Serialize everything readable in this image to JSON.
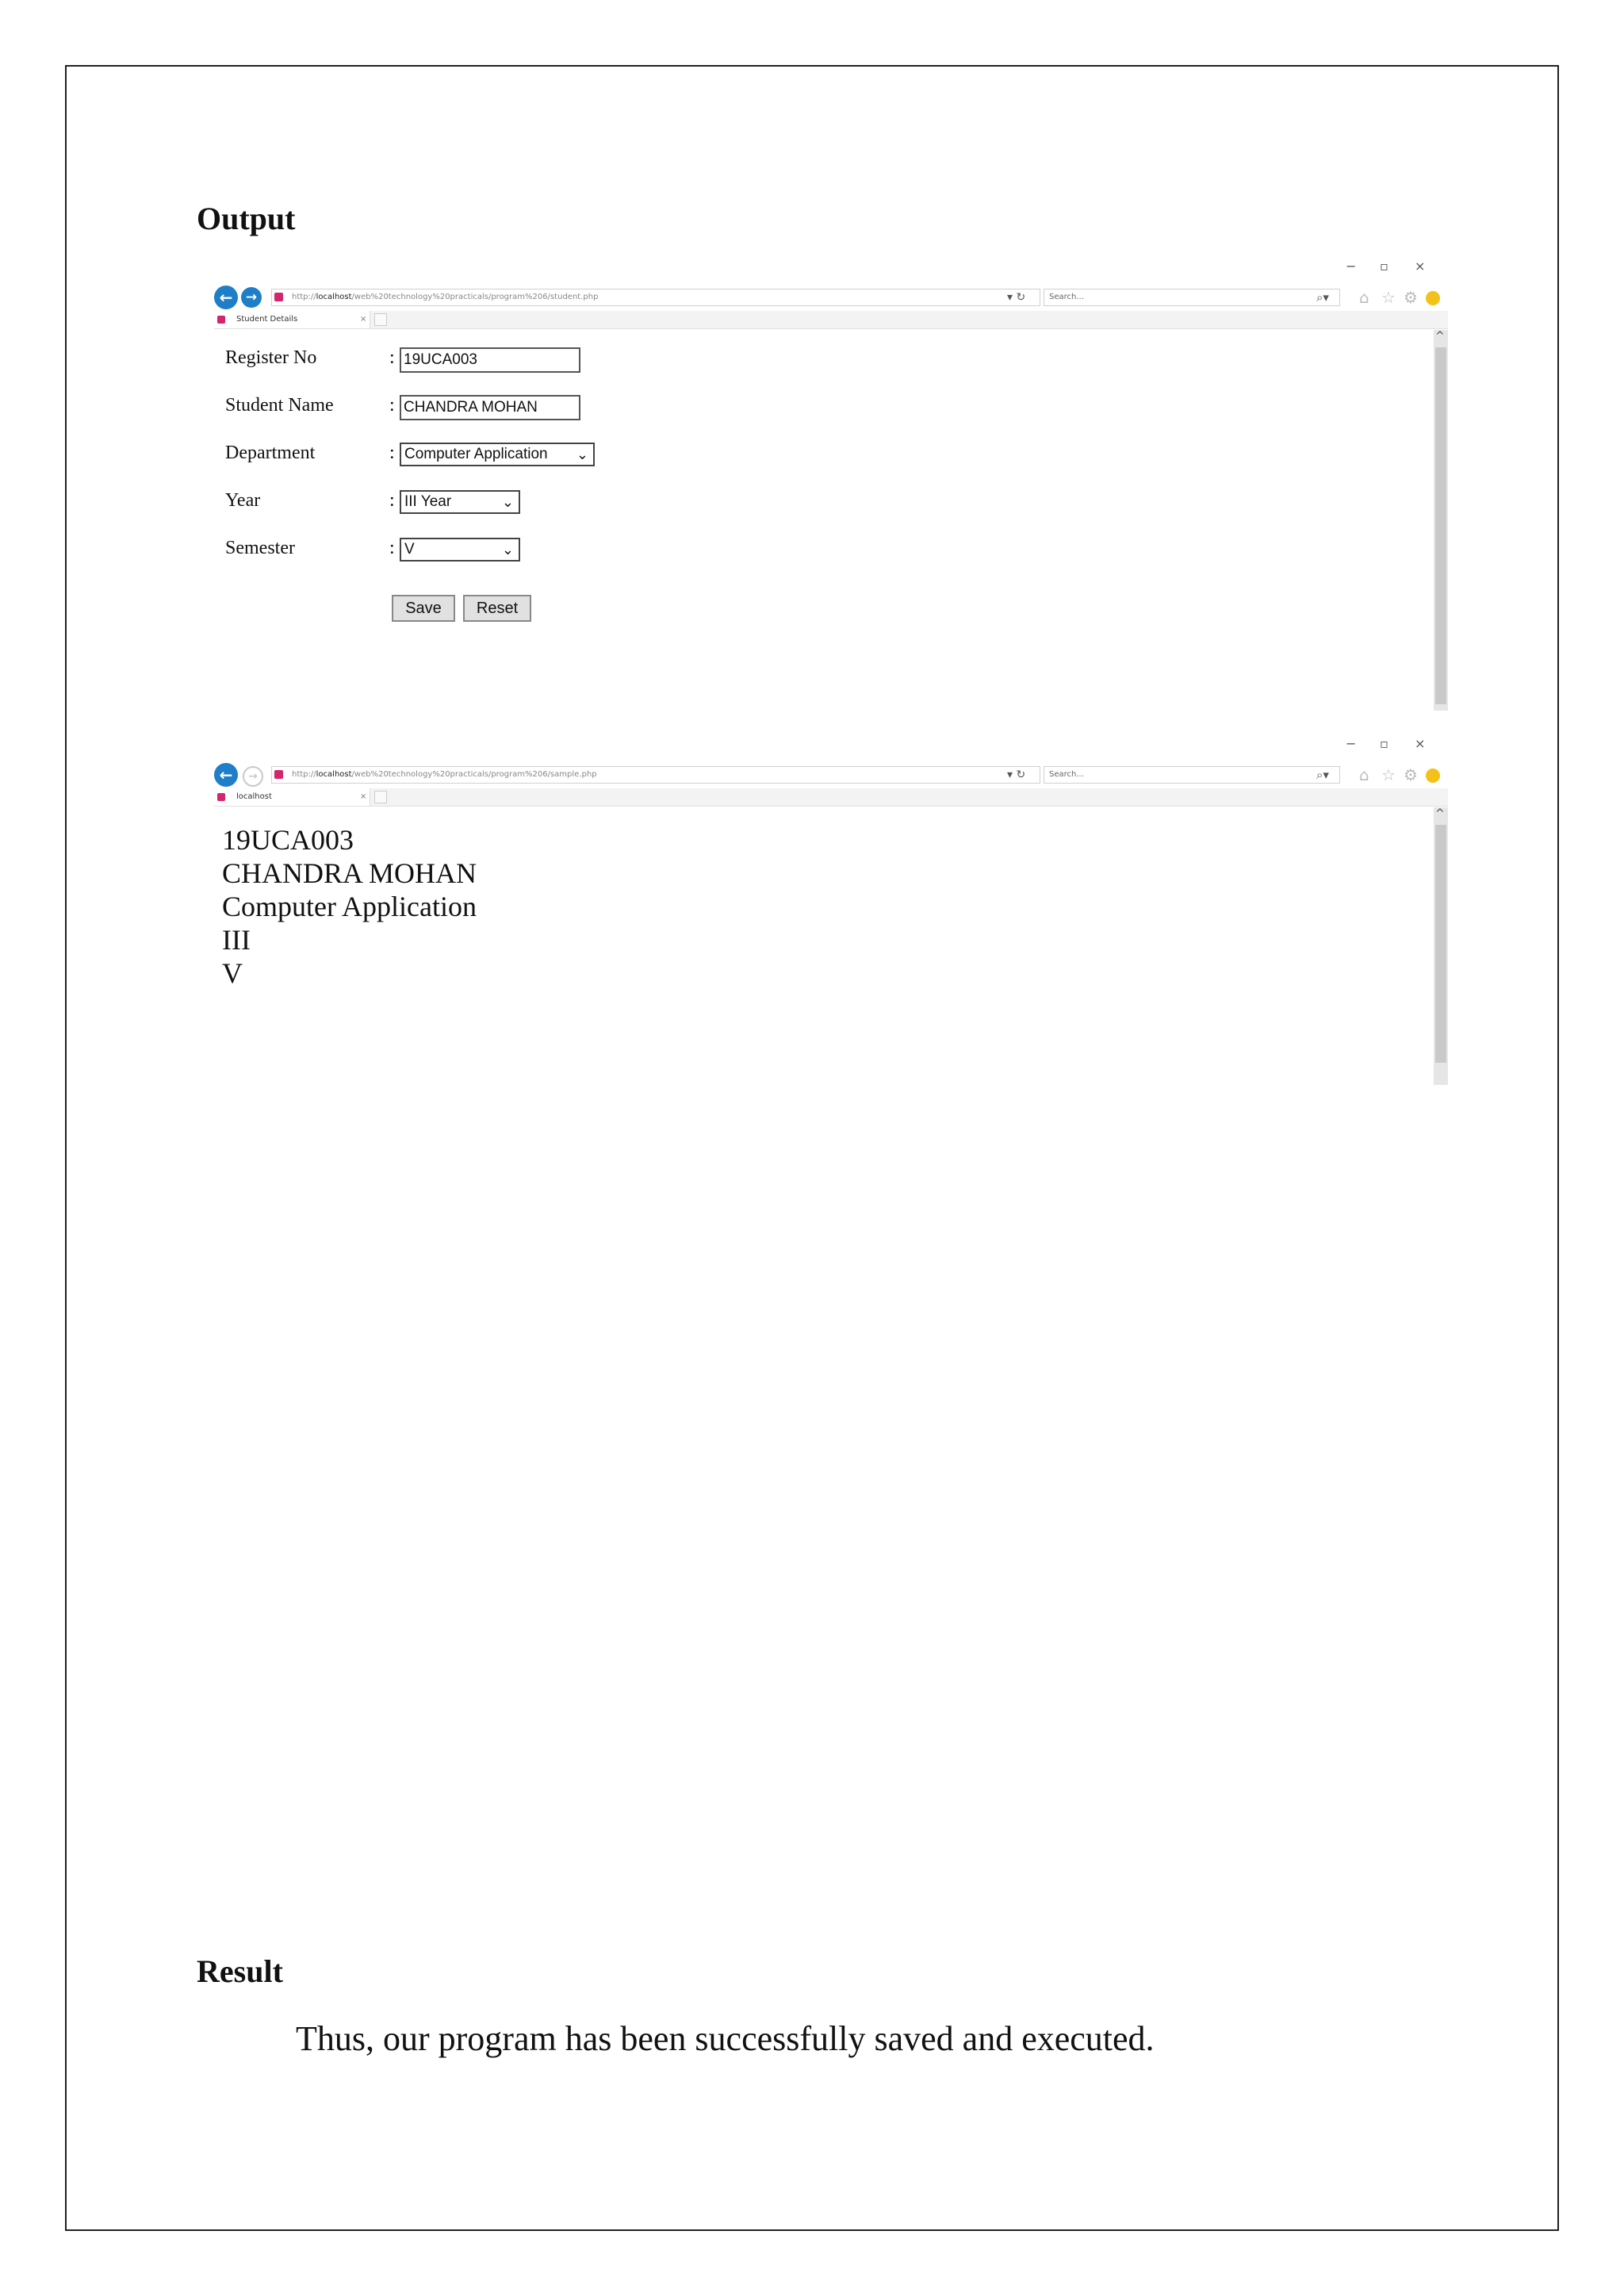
{
  "output_heading": "Output",
  "result_heading": "Result",
  "result_text": "Thus, our program has been successfully saved and executed.",
  "browser1": {
    "url_prefix": "http://",
    "url_host": "localhost",
    "url_path": "/web%20technology%20practicals/program%206/student.php",
    "search_placeholder": "Search...",
    "tab_title": "Student Details",
    "form": {
      "register_label": "Register No",
      "register_value": "19UCA003",
      "name_label": "Student Name",
      "name_value": "CHANDRA MOHAN",
      "department_label": "Department",
      "department_value": "Computer Application",
      "year_label": "Year",
      "year_value": "III Year",
      "semester_label": "Semester",
      "semester_value": "V",
      "colon": ":",
      "save_label": "Save",
      "reset_label": "Reset"
    }
  },
  "browser2": {
    "url_prefix": "http://",
    "url_host": "localhost",
    "url_path": "/web%20technology%20practicals/program%206/sample.php",
    "search_placeholder": "Search...",
    "tab_title": "localhost",
    "output_lines": [
      "19UCA003",
      "CHANDRA MOHAN",
      "Computer Application",
      "III",
      "V"
    ]
  },
  "colors": {
    "accent": "#1e7fc8",
    "favicon": "#d6246e",
    "smiley": "#f2c21b"
  },
  "icons": [
    "back-arrow-icon",
    "forward-arrow-icon",
    "refresh-icon",
    "search-icon",
    "home-icon",
    "star-icon",
    "gear-icon",
    "smiley-icon",
    "close-icon",
    "minimize-icon",
    "restore-icon"
  ]
}
